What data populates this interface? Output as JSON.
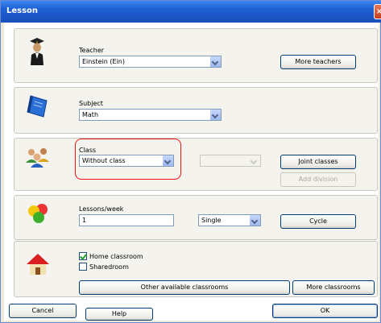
{
  "window": {
    "title": "Lesson",
    "close_glyph": "×"
  },
  "teacher": {
    "label": "Teacher",
    "value": "Einstein (Ein)",
    "more_button": "More teachers"
  },
  "subject": {
    "label": "Subject",
    "value": "Math"
  },
  "class": {
    "label": "Class",
    "value": "Without class",
    "secondary_value": "",
    "joint_button": "Joint classes",
    "division_button": "Add division"
  },
  "lessons": {
    "label": "Lessons/week",
    "value": "1",
    "mode": "Single",
    "cycle_button": "Cycle"
  },
  "classroom": {
    "home_label": "Home classroom",
    "home_checked": true,
    "shared_label": "Sharedroom",
    "shared_checked": false,
    "other_button": "Other available classrooms",
    "more_button": "More classrooms"
  },
  "footer": {
    "cancel": "Cancel",
    "help": "Help",
    "ok": "OK"
  },
  "icons": [
    "teacher-icon",
    "book-icon",
    "students-icon",
    "balls-icon",
    "house-icon"
  ]
}
